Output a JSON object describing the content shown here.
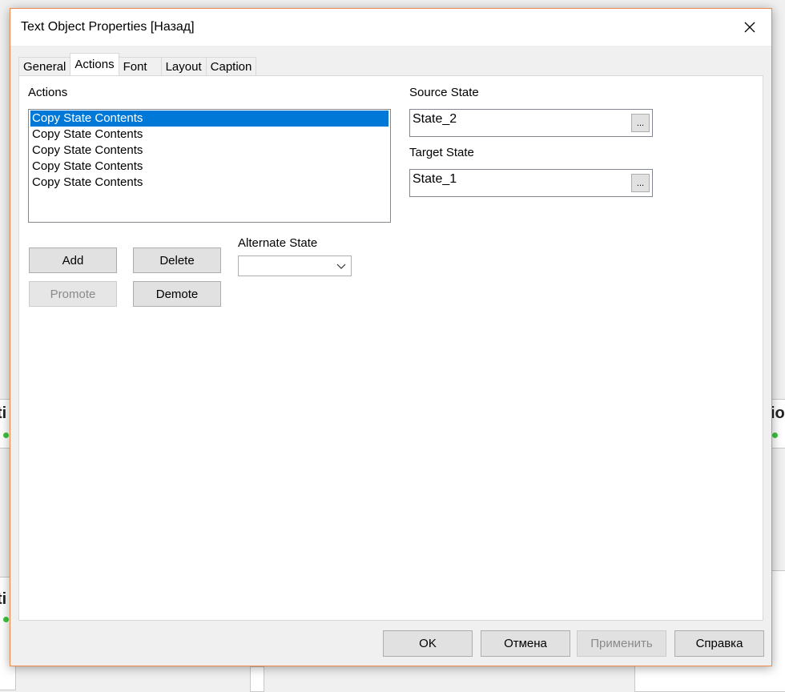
{
  "dialog": {
    "title": "Text Object Properties [Назад]",
    "close_icon": "close-icon"
  },
  "tabs": [
    {
      "label": "General",
      "active": false
    },
    {
      "label": "Actions",
      "active": true
    },
    {
      "label": "Font",
      "active": false
    },
    {
      "label": "Layout",
      "active": false
    },
    {
      "label": "Caption",
      "active": false
    }
  ],
  "actions": {
    "label": "Actions",
    "items": [
      {
        "label": "Copy State Contents",
        "selected": true
      },
      {
        "label": "Copy State Contents",
        "selected": false
      },
      {
        "label": "Copy State Contents",
        "selected": false
      },
      {
        "label": "Copy State Contents",
        "selected": false
      },
      {
        "label": "Copy State Contents",
        "selected": false
      }
    ],
    "buttons": {
      "add": "Add",
      "delete": "Delete",
      "promote": "Promote",
      "demote": "Demote"
    },
    "alternate_state": {
      "label": "Alternate State",
      "value": ""
    },
    "source_state": {
      "label": "Source State",
      "value": "State_2",
      "browse": "..."
    },
    "target_state": {
      "label": "Target State",
      "value": "State_1",
      "browse": "..."
    }
  },
  "footer": {
    "ok": "OK",
    "cancel": "Отмена",
    "apply": "Применить",
    "help": "Справка"
  },
  "background": {
    "fragment_left": "ti",
    "fragment_right": "io",
    "fragment_left_lower": "ti"
  },
  "colors": {
    "accent": "#0078d7",
    "dialog_border": "#f08a4b",
    "status_dot": "#3cc43c"
  }
}
